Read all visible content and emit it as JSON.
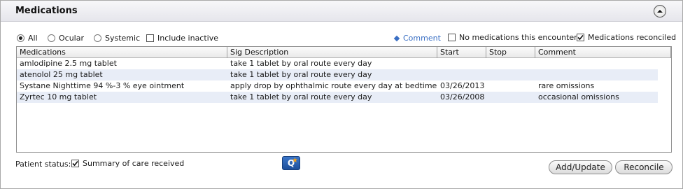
{
  "header": {
    "title": "Medications",
    "collapse_icon": "chevron-up-icon"
  },
  "filters": {
    "all_label": "All",
    "ocular_label": "Ocular",
    "systemic_label": "Systemic",
    "selected": "All",
    "include_inactive_label": "Include inactive",
    "include_inactive_checked": false
  },
  "encounter": {
    "comment_link": "Comment",
    "no_meds_label": "No medications this encounter",
    "no_meds_checked": false,
    "reconciled_label": "Medications reconciled",
    "reconciled_checked": true
  },
  "table": {
    "columns": [
      "Medications",
      "Sig Description",
      "Start",
      "Stop",
      "Comment"
    ],
    "rows": [
      {
        "medication": "amlodipine 2.5 mg tablet",
        "sig": "take 1 tablet by oral route  every day",
        "start": "",
        "stop": "",
        "comment": ""
      },
      {
        "medication": "atenolol 25 mg tablet",
        "sig": "take 1 tablet by oral route  every day",
        "start": "",
        "stop": "",
        "comment": ""
      },
      {
        "medication": "Systane Nighttime 94 %-3 % eye ointment",
        "sig": "apply drop by ophthalmic route  every day at bedtime",
        "start": "03/26/2013",
        "stop": "",
        "comment": "rare omissions"
      },
      {
        "medication": "Zyrtec 10 mg tablet",
        "sig": "take 1 tablet by oral route  every day",
        "start": "03/26/2008",
        "stop": "",
        "comment": "occasional omissions"
      }
    ]
  },
  "footer": {
    "patient_status_label": "Patient status:",
    "summary_label": "Summary of care received",
    "summary_checked": true,
    "quick_icon": "q-icon",
    "add_update_label": "Add/Update",
    "reconcile_label": "Reconcile"
  },
  "colors": {
    "link": "#3a6fc4",
    "alt_row": "#e8edf7",
    "header_bg": "#e6e6ec"
  }
}
